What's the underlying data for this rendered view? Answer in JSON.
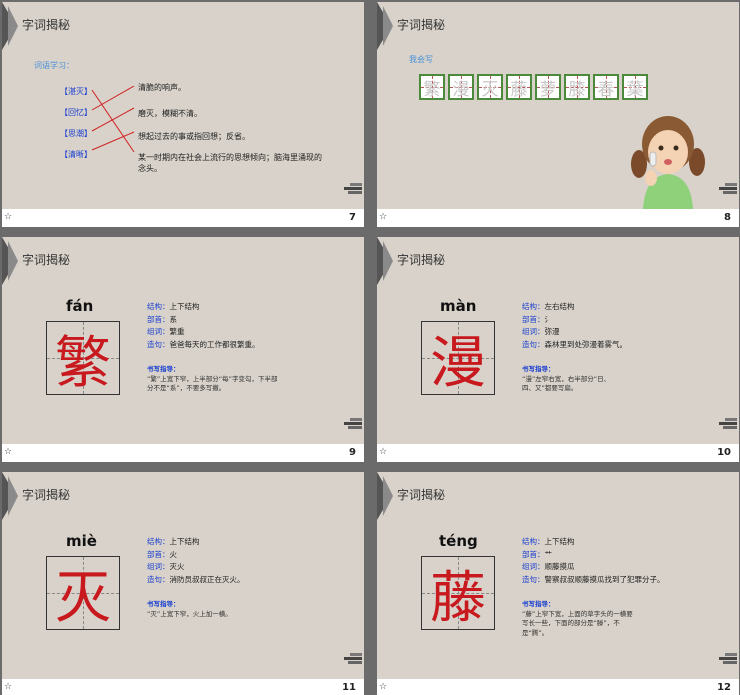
{
  "slides": [
    {
      "title": "字词揭秘",
      "number": "7",
      "footer_mark": "☆",
      "subtitle": "词语学习：",
      "words": [
        "【湛灭】",
        "【回忆】",
        "【思潮】",
        "【清晰】"
      ],
      "definitions": [
        "清脆的响声。",
        "磨灭，模糊不清。",
        "想起过去的事或指回想；反省。",
        "某一时期内在社会上流行的思想倾向；脑海里涌现的念头。"
      ]
    },
    {
      "title": "字词揭秘",
      "number": "8",
      "footer_mark": "☆",
      "label": "我会写",
      "chars": [
        "繁",
        "漫",
        "灭",
        "藤",
        "萝",
        "膝",
        "春",
        "葉"
      ]
    },
    {
      "title": "字词揭秘",
      "number": "9",
      "footer_mark": "☆",
      "pinyin": "fán",
      "char": "繁",
      "structure_key": "结构：",
      "structure_val": "上下结构",
      "radical_key": "部首：",
      "radical_val": "系",
      "word_key": "组词：",
      "word_val": "繁重",
      "sentence_key": "造句：",
      "sentence_val": "爸爸每天的工作都很繁重。",
      "guide_key": "书写指导：",
      "guide_val": "“繁”上宽下窄，上半部分“每”字变勾，下半部分不是“系”，不要多写撇。"
    },
    {
      "title": "字词揭秘",
      "number": "10",
      "footer_mark": "☆",
      "pinyin": "màn",
      "char": "漫",
      "structure_key": "结构：",
      "structure_val": "左右结构",
      "radical_key": "部首：",
      "radical_val": "氵",
      "word_key": "组词：",
      "word_val": "弥漫",
      "sentence_key": "造句：",
      "sentence_val": "森林里到处弥漫着雾气。",
      "guide_key": "书写指导：",
      "guide_val": "“漫”左窄右宽，右半部分“日、四、又”都要写扁。"
    },
    {
      "title": "字词揭秘",
      "number": "11",
      "footer_mark": "☆",
      "pinyin": "miè",
      "char": "灭",
      "structure_key": "结构：",
      "structure_val": "上下结构",
      "radical_key": "部首：",
      "radical_val": "火",
      "word_key": "组词：",
      "word_val": "灭火",
      "sentence_key": "造句：",
      "sentence_val": "消防员叔叔正在灭火。",
      "guide_key": "书写指导：",
      "guide_val": "“灭”上宽下窄，火上加一横。"
    },
    {
      "title": "字词揭秘",
      "number": "12",
      "footer_mark": "☆",
      "pinyin": "téng",
      "char": "藤",
      "structure_key": "结构：",
      "structure_val": "上下结构",
      "radical_key": "部首：",
      "radical_val": "艹",
      "word_key": "组词：",
      "word_val": "顺藤摸瓜",
      "sentence_key": "造句：",
      "sentence_val": "警察叔叔顺藤摸瓜找到了犯罪分子。",
      "guide_key": "书写指导：",
      "guide_val": "“藤”上窄下宽，上面的草字头的一横要写长一些，下面的部分是“滕”，不是“腾”。"
    }
  ]
}
